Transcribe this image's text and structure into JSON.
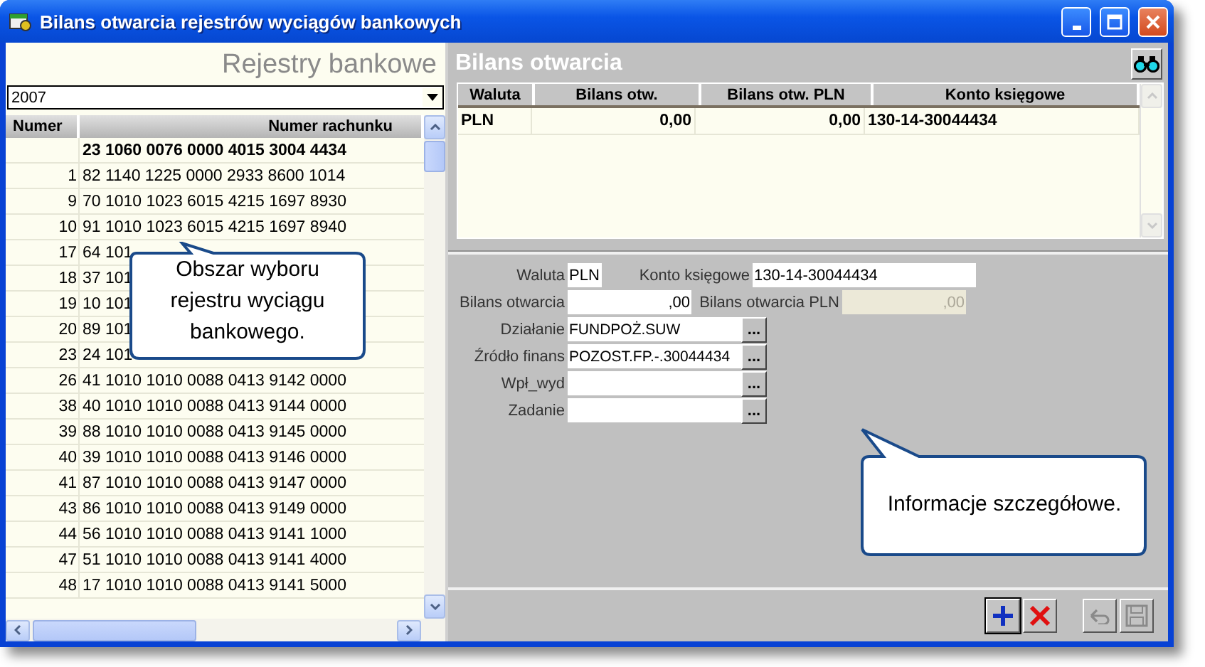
{
  "window": {
    "title": "Bilans otwarcia rejestrów wyciągów bankowych"
  },
  "registers": {
    "title": "Rejestry bankowe",
    "year_select": {
      "value": "2007"
    },
    "columns": [
      "Numer",
      "Numer rachunku"
    ],
    "rows": [
      {
        "number": "",
        "account": "23 1060 0076 0000 4015 3004 4434",
        "selected": true
      },
      {
        "number": "1",
        "account": "82 1140 1225 0000 2933 8600 1014",
        "selected": false
      },
      {
        "number": "9",
        "account": "70 1010 1023 6015 4215 1697 8930",
        "selected": false
      },
      {
        "number": "10",
        "account": "91 1010 1023 6015 4215 1697 8940",
        "selected": false
      },
      {
        "number": "17",
        "account": "64 101",
        "selected": false
      },
      {
        "number": "18",
        "account": "37 101",
        "selected": false
      },
      {
        "number": "19",
        "account": "10 101",
        "selected": false
      },
      {
        "number": "20",
        "account": "89 101",
        "selected": false
      },
      {
        "number": "23",
        "account": "24 101",
        "selected": false
      },
      {
        "number": "26",
        "account": "41 1010 1010 0088 0413 9142 0000",
        "selected": false
      },
      {
        "number": "38",
        "account": "40 1010 1010 0088 0413 9144 0000",
        "selected": false
      },
      {
        "number": "39",
        "account": "88 1010 1010 0088 0413 9145 0000",
        "selected": false
      },
      {
        "number": "40",
        "account": "39 1010 1010 0088 0413 9146 0000",
        "selected": false
      },
      {
        "number": "41",
        "account": "87 1010 1010 0088 0413 9147 0000",
        "selected": false
      },
      {
        "number": "43",
        "account": "86 1010 1010 0088 0413 9149 0000",
        "selected": false
      },
      {
        "number": "44",
        "account": "56 1010 1010 0088 0413 9141 1000",
        "selected": false
      },
      {
        "number": "47",
        "account": "51 1010 1010 0088 0413 9141 4000",
        "selected": false
      },
      {
        "number": "48",
        "account": "17 1010 1010 0088 0413 9141 5000",
        "selected": false
      }
    ],
    "callout": {
      "text": "Obszar wyboru rejestru wyciągu bankowego."
    }
  },
  "balance": {
    "title": "Bilans otwarcia",
    "columns": [
      "Waluta",
      "Bilans otw.",
      "Bilans otw. PLN",
      "Konto księgowe"
    ],
    "rows": [
      {
        "currency": "PLN",
        "balance": "0,00",
        "balance_pln": "0,00",
        "account": "130-14-30044434"
      }
    ]
  },
  "form": {
    "rows": [
      [
        {
          "label": "Waluta",
          "value": "PLN",
          "kind": "short",
          "disabled": false
        },
        {
          "label": "Konto księgowe",
          "value": "130-14-30044434",
          "kind": "wide",
          "disabled": false
        }
      ],
      [
        {
          "label": "Bilans otwarcia",
          "value": ",00",
          "kind": "amount",
          "disabled": false
        },
        {
          "label": "Bilans otwarcia PLN",
          "value": ",00",
          "kind": "amount",
          "disabled": true
        }
      ],
      [
        {
          "label": "Działanie",
          "value": "FUNDPOŻ.SUW",
          "kind": "lookup",
          "button": "...",
          "disabled": false
        }
      ],
      [
        {
          "label": "Źródło finans",
          "value": "POZOST.FP.-.30044434",
          "kind": "lookup",
          "button": "...",
          "disabled": false
        }
      ],
      [
        {
          "label": "Wpł_wyd",
          "kind": "lookup",
          "button": "...",
          "disabled": false
        }
      ],
      [
        {
          "label": "Zadanie",
          "kind": "lookup",
          "button": "...",
          "disabled": false
        }
      ]
    ],
    "callout": {
      "text": "Informacje szczegółowe."
    }
  },
  "toolbar": [
    {
      "kind": "add",
      "disabled": false
    },
    {
      "kind": "delete",
      "disabled": false
    },
    {
      "kind": "undo",
      "disabled": true
    },
    {
      "kind": "save",
      "disabled": true
    }
  ]
}
